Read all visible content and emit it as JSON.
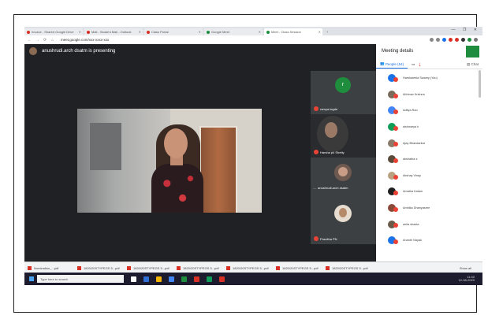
{
  "browser": {
    "tabs": [
      {
        "label": "Invoice - Shared Google Drive"
      },
      {
        "label": "Mail - Student Mail - Outlook"
      },
      {
        "label": "Class Portal"
      },
      {
        "label": "Google Meet"
      },
      {
        "label": "Meet - Class Session",
        "active": true
      }
    ],
    "window_controls": "— ❐ ✕",
    "url": "meet.google.com/xxx-xxxx-xxx"
  },
  "meet": {
    "presenting_text": "anushrudi.arch dsatm is presenting",
    "tiles": [
      {
        "name": "ramya tegde",
        "avatar_letter": "r",
        "avatar_color": "#1e8e3e"
      },
      {
        "name": "Harsha pk Shetty"
      },
      {
        "name": "anushrudi.arch dsatm"
      },
      {
        "name": "Pranitha PN"
      }
    ]
  },
  "panel": {
    "title": "Meeting details",
    "people_tab": "People (54)",
    "chat_tab": "Chat",
    "people": [
      {
        "name": "Harshaleela Swamy (You)",
        "color": "#1a73e8"
      },
      {
        "name": "Abhinav Krishna",
        "color": "#7a6a5a"
      },
      {
        "name": "Aditya Rao",
        "color": "#4285f4"
      },
      {
        "name": "aishwarya k",
        "color": "#0f9d58"
      },
      {
        "name": "Ajay Bhandarkar",
        "color": "#8a7a6a"
      },
      {
        "name": "akshatha s",
        "color": "#5a4a3a"
      },
      {
        "name": "Akshay Vinay",
        "color": "#b8a080"
      },
      {
        "name": "Amatha Katam",
        "color": "#1f1f1f"
      },
      {
        "name": "Ambika Dhanyasree",
        "color": "#8a4a3a"
      },
      {
        "name": "anita shasta",
        "color": "#6a5a4a"
      },
      {
        "name": "Ananth Nayak",
        "color": "#1a73e8"
      }
    ]
  },
  "downloads": {
    "items": [
      "Nomination_...pdf",
      "1820/20STYPEGS 5...pdf",
      "1820/20STYPEGS 5...pdf",
      "1820/20STYPEGS 5...pdf",
      "1820/20STYPEGS 5...pdf",
      "1820/20STYPEGS 5...pdf",
      "1820/20STYPEGS 5...pdf"
    ],
    "show_all": "Show all"
  },
  "taskbar": {
    "search_placeholder": "Type here to search",
    "time": "11:40",
    "date": "12-08-2020"
  }
}
